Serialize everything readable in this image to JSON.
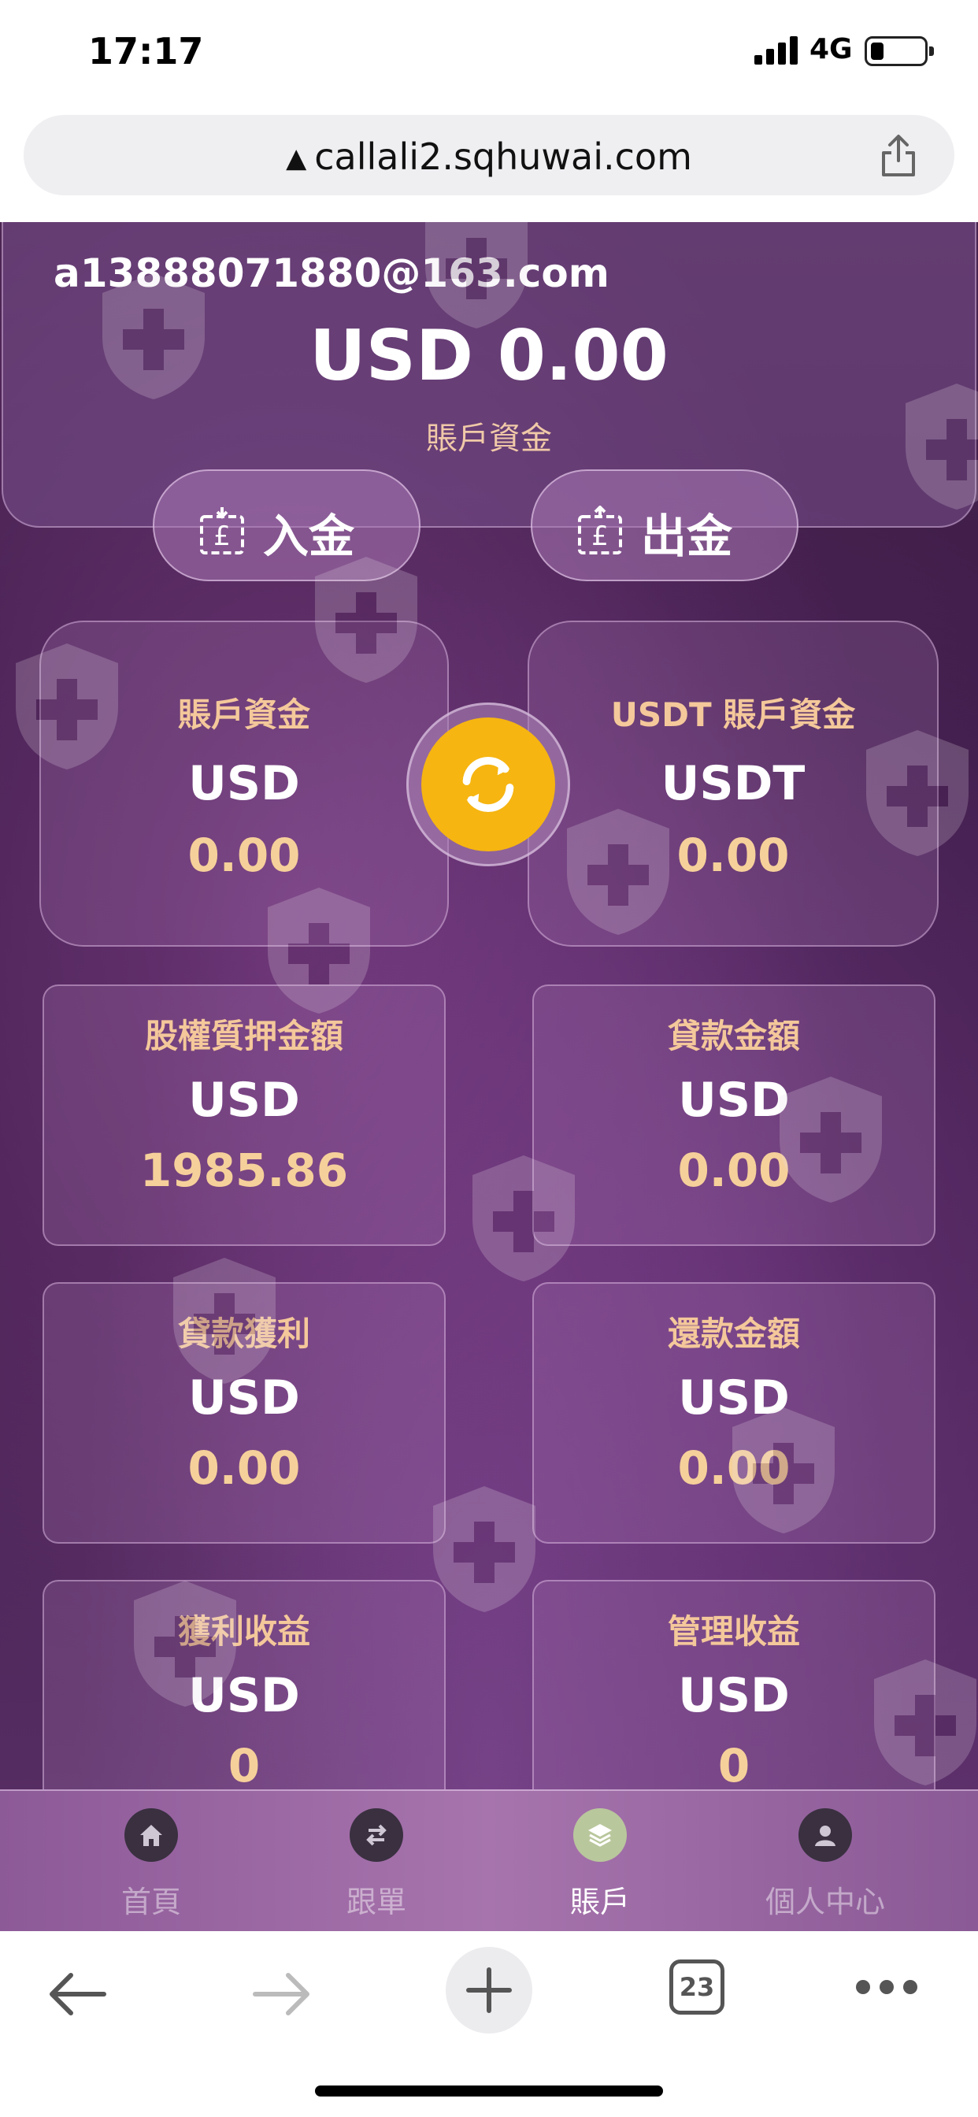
{
  "status_bar": {
    "time": "17:17",
    "network": "4G"
  },
  "browser": {
    "url": "callali2.sqhuwai.com",
    "tabs_count": "23"
  },
  "account": {
    "email": "a13888071880@163.com",
    "balance": "USD 0.00",
    "balance_label": "賬戶資金"
  },
  "actions": {
    "deposit_label": "入金",
    "withdraw_label": "出金"
  },
  "cards": [
    {
      "title": "賬戶資金",
      "currency": "USD",
      "value": "0.00"
    },
    {
      "title": "USDT 賬戶資金",
      "currency": "USDT",
      "value": "0.00"
    },
    {
      "title": "股權質押金額",
      "currency": "USD",
      "value": "1985.86"
    },
    {
      "title": "貸款金額",
      "currency": "USD",
      "value": "0.00"
    },
    {
      "title": "貸款獲利",
      "currency": "USD",
      "value": "0.00"
    },
    {
      "title": "還款金額",
      "currency": "USD",
      "value": "0.00"
    },
    {
      "title": "獲利收益",
      "currency": "USD",
      "value": "0"
    },
    {
      "title": "管理收益",
      "currency": "USD",
      "value": "0"
    }
  ],
  "tab_bar": [
    {
      "label": "首頁",
      "icon": "home-icon"
    },
    {
      "label": "跟單",
      "icon": "swap-icon"
    },
    {
      "label": "賬戶",
      "icon": "layers-icon",
      "active": true
    },
    {
      "label": "個人中心",
      "icon": "user-icon"
    }
  ],
  "colors": {
    "accent_orange": "#f6b511",
    "card_title": "#f4c89a",
    "background": "#45204f"
  }
}
